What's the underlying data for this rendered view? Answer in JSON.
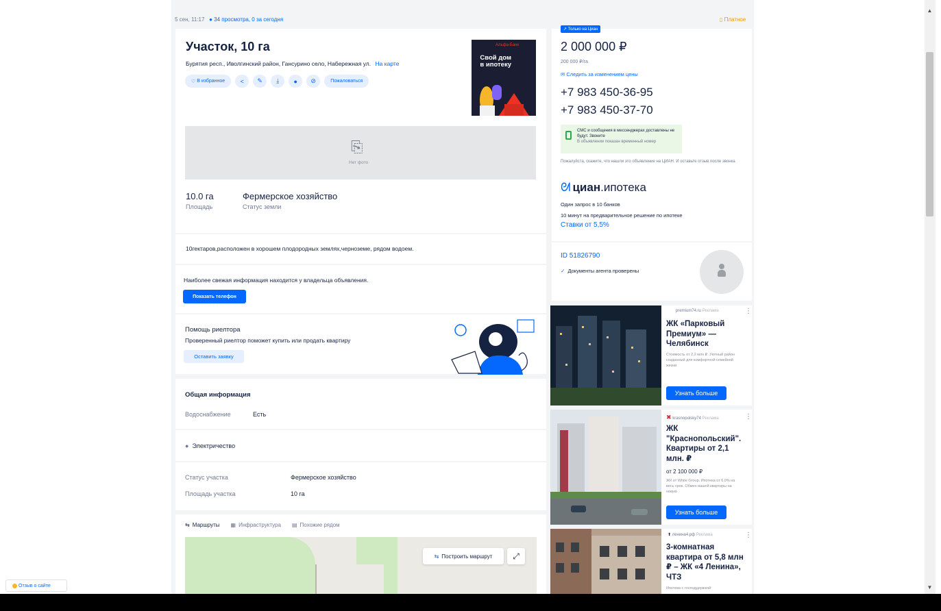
{
  "listing": {
    "published": "5 сен, 11:17",
    "views": "34 просмотра, 0 за сегодня",
    "paid_label": "Платное",
    "title": "Участок, 10 га",
    "address": "Бурятия респ., Иволгинский район, Гансурино село, Набережная ул.",
    "on_map": "На карте",
    "favorite_label": "В избранное",
    "complain_label": "Пожаловаться",
    "no_photo": "Нет фото",
    "stats": [
      {
        "value": "10.0 га",
        "label": "Площадь"
      },
      {
        "value": "Фермерское хозяйство",
        "label": "Статус земли"
      }
    ],
    "description": "10гектаров,расположен в хорошем плодородных землях,черноземе, рядом водоем.",
    "fresh_info": "Наиболее свежая информация находится у владельца объявления.",
    "show_phone": "Показать телефон"
  },
  "ad_banner": {
    "brand": "Альфа-Банк",
    "text": "Свой дом в ипотеку"
  },
  "realtor_help": {
    "title": "Помощь риелтора",
    "text": "Проверенный риелтор поможет купить или продать квартиру",
    "button": "Оставить заявку"
  },
  "general_info": {
    "title": "Общая информация",
    "water_label": "Водоснабжение",
    "water_value": "Есть",
    "electricity": "Электричество",
    "plot_status_label": "Статус участка",
    "plot_status_value": "Фермерское хозяйство",
    "plot_area_label": "Площадь участка",
    "plot_area_value": "10 га"
  },
  "map_section": {
    "tabs": [
      "Маршруты",
      "Инфраструктура",
      "Похожие рядом"
    ],
    "route_button": "Построить маршрут"
  },
  "sidebar": {
    "badge": "Только на Циан",
    "price": "2 000 000 ₽",
    "price_per_area": "200 000 ₽/га",
    "follow_price": "Следить за изменением цены",
    "phones": [
      "+7 983 450-36-95",
      "+7 983 450-37-70"
    ],
    "sms_note": "СМС и сообщения в мессенджерах доставлены не будут. Звоните",
    "sms_sub": "В объявлении показан временный номер",
    "remind": "Пожалуйста, скажите, что нашли это объявление на ЦИАН. И оставьте отзыв после звонка",
    "cian_brand": "циан",
    "cian_product": ".ипотека",
    "mortgage_line1": "Один запрос в 10 банков",
    "mortgage_line2": "10 минут на предварительное решение по ипотеке",
    "rates": "Ставки от 5,5%",
    "listing_id": "ID 51826790",
    "docs_checked": "Документы агента проверены"
  },
  "ads": [
    {
      "source": "premium74.ru",
      "tag": "Реклама",
      "title": "ЖК «Парковый Премиум» — Челябинск",
      "sub": "Стоимость от 2,2 млн ₽. Уютный район созданный для комфортной семейной жизни",
      "button": "Узнать больше"
    },
    {
      "source": "krasnopolsky74",
      "tag": "Реклама",
      "title": "ЖК \"Краснопольский\". Квартиры от 2,1 млн. ₽",
      "price": "от 2 100 000 ₽",
      "sub": "ЖК от White Group. Ипотека от 6,0% на весь срок. Обмен вашей квартиры на новую",
      "button": "Узнать больше"
    },
    {
      "source": "ленина4.рф",
      "tag": "Реклама",
      "title": "3-комнатная квартира от 5,8 млн ₽ – ЖК «4 Ленина», ЧТЗ",
      "sub": "Ипотека с господдержкой"
    }
  ],
  "feedback": "Отзыв о сайте"
}
